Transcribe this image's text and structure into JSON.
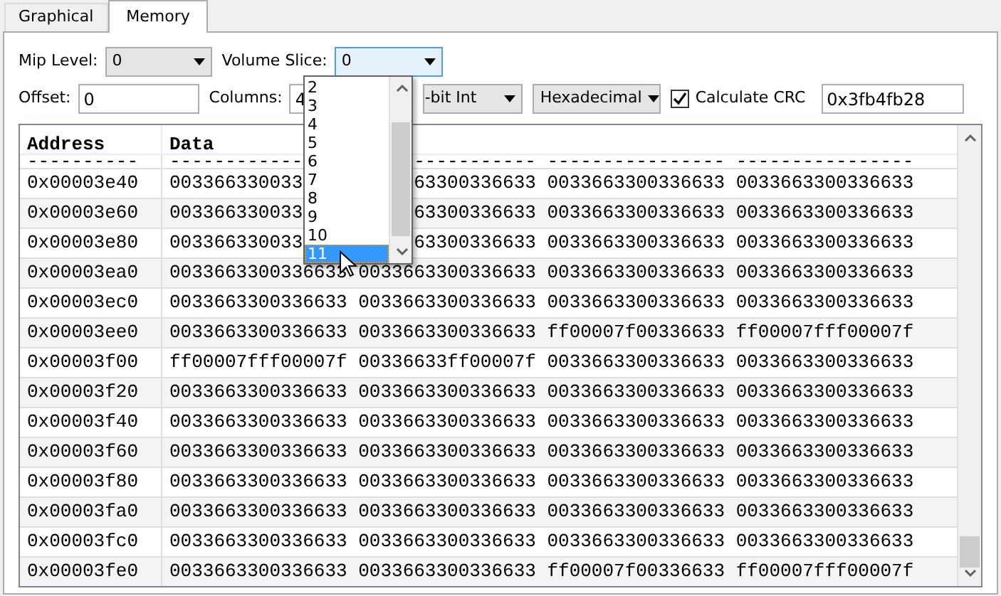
{
  "tabs": [
    {
      "label": "Graphical",
      "selected": false
    },
    {
      "label": "Memory",
      "selected": true
    }
  ],
  "controls": {
    "mip_level": {
      "label": "Mip Level:",
      "value": "0"
    },
    "volume_slice": {
      "label": "Volume Slice:",
      "value": "0",
      "expanded": true,
      "options": [
        {
          "label": "2",
          "selected": false
        },
        {
          "label": "3",
          "selected": false
        },
        {
          "label": "4",
          "selected": false
        },
        {
          "label": "5",
          "selected": false
        },
        {
          "label": "6",
          "selected": false
        },
        {
          "label": "7",
          "selected": false
        },
        {
          "label": "8",
          "selected": false
        },
        {
          "label": "9",
          "selected": false
        },
        {
          "label": "10",
          "selected": false
        },
        {
          "label": "11",
          "selected": true
        }
      ]
    },
    "offset": {
      "label": "Offset:",
      "value": "0"
    },
    "columns": {
      "label": "Columns:",
      "value": "4"
    },
    "format": {
      "value": "-bit Int"
    },
    "display": {
      "value": "Hexadecimal"
    },
    "crc": {
      "label": "Calculate CRC",
      "checked": true,
      "value": "0x3fb4fb28"
    }
  },
  "table": {
    "columns": [
      "Address",
      "Data"
    ],
    "rows": [
      {
        "address": "----------",
        "values": [
          "------------",
          "-----------",
          "----------------",
          "----------------"
        ],
        "kind": "separator"
      },
      {
        "address": "0x00003e40",
        "values": [
          "003366330033",
          "63300336633",
          "0033663300336633",
          "0033663300336633"
        ]
      },
      {
        "address": "0x00003e60",
        "values": [
          "003366330033",
          "63300336633",
          "0033663300336633",
          "0033663300336633"
        ]
      },
      {
        "address": "0x00003e80",
        "values": [
          "003366330033",
          "63300336633",
          "0033663300336633",
          "0033663300336633"
        ]
      },
      {
        "address": "0x00003ea0",
        "values": [
          "0033663300336633",
          "0033663300336633",
          "0033663300336633",
          "0033663300336633"
        ]
      },
      {
        "address": "0x00003ec0",
        "values": [
          "0033663300336633",
          "0033663300336633",
          "0033663300336633",
          "0033663300336633"
        ]
      },
      {
        "address": "0x00003ee0",
        "values": [
          "0033663300336633",
          "0033663300336633",
          "ff00007f00336633",
          "ff00007fff00007f"
        ]
      },
      {
        "address": "0x00003f00",
        "values": [
          "ff00007fff00007f",
          "00336633ff00007f",
          "0033663300336633",
          "0033663300336633"
        ]
      },
      {
        "address": "0x00003f20",
        "values": [
          "0033663300336633",
          "0033663300336633",
          "0033663300336633",
          "0033663300336633"
        ]
      },
      {
        "address": "0x00003f40",
        "values": [
          "0033663300336633",
          "0033663300336633",
          "0033663300336633",
          "0033663300336633"
        ]
      },
      {
        "address": "0x00003f60",
        "values": [
          "0033663300336633",
          "0033663300336633",
          "0033663300336633",
          "0033663300336633"
        ]
      },
      {
        "address": "0x00003f80",
        "values": [
          "0033663300336633",
          "0033663300336633",
          "0033663300336633",
          "0033663300336633"
        ]
      },
      {
        "address": "0x00003fa0",
        "values": [
          "0033663300336633",
          "0033663300336633",
          "0033663300336633",
          "0033663300336633"
        ]
      },
      {
        "address": "0x00003fc0",
        "values": [
          "0033663300336633",
          "0033663300336633",
          "0033663300336633",
          "0033663300336633"
        ]
      },
      {
        "address": "0x00003fe0",
        "values": [
          "0033663300336633",
          "0033663300336633",
          "ff00007f00336633",
          "ff00007fff00007f"
        ]
      }
    ]
  }
}
